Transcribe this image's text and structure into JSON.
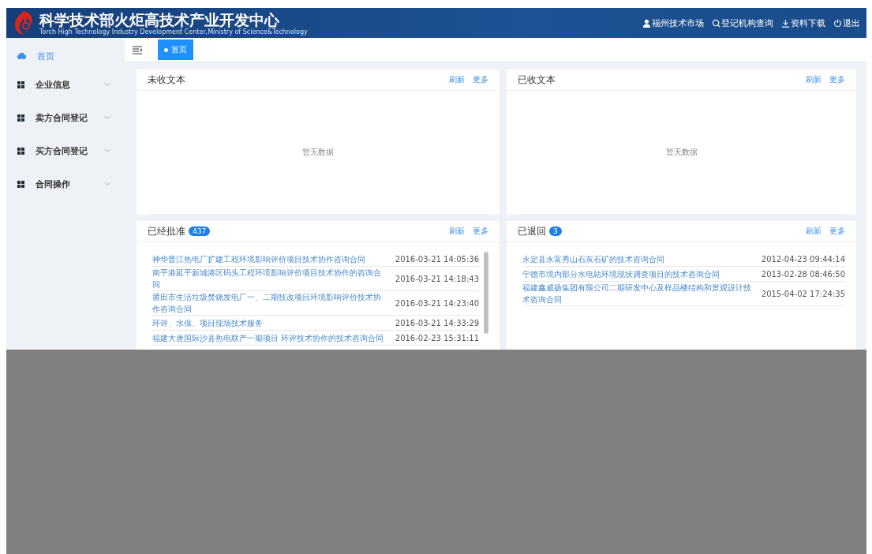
{
  "header": {
    "title": "科学技术部火炬高技术产业开发中心",
    "subtitle": "Torch High Technology Industry Development Center,Ministry of Science&Technology",
    "links": [
      {
        "kind": "user",
        "label": "福州技术市场"
      },
      {
        "kind": "search",
        "label": "登记机构查询"
      },
      {
        "kind": "download",
        "label": "资料下载"
      },
      {
        "kind": "power",
        "label": "退出"
      }
    ]
  },
  "sidebar": {
    "items": [
      {
        "kind": "home",
        "label": "首页",
        "selected": true
      },
      {
        "kind": "group",
        "label": "企业信息",
        "selected": false,
        "expanded": false
      },
      {
        "kind": "group",
        "label": "卖方合同登记",
        "selected": false,
        "expanded": false
      },
      {
        "kind": "group",
        "label": "买方合同登记",
        "selected": false,
        "expanded": false
      },
      {
        "kind": "group",
        "label": "合同操作",
        "selected": false,
        "expanded": false
      }
    ]
  },
  "tabs": [
    {
      "label": "首页",
      "selected": true
    }
  ],
  "panels": [
    {
      "title": "未收文本",
      "actions": [
        "刷新",
        "更多"
      ],
      "empty_text": "暂无数据"
    },
    {
      "title": "已收文本",
      "actions": [
        "刷新",
        "更多"
      ],
      "empty_text": "暂无数据"
    },
    {
      "title": "已经批准",
      "badge": "437",
      "actions": [
        "刷新",
        "更多"
      ],
      "scrollable": true,
      "rows": [
        {
          "title": "神华晋江热电厂扩建工程环境影响评价项目技术协作咨询合同",
          "date": "2016-03-21 14:05:36"
        },
        {
          "title": "南平港延平新城港区码头工程环境影响评价项目技术协作的咨询合同",
          "date": "2016-03-21 14:18:43"
        },
        {
          "title": "莆田市生活垃圾焚烧发电厂一、二期技改项目环境影响评价技术协作咨询合同",
          "date": "2016-03-21 14:23:40"
        },
        {
          "title": "环评、水保、项目现场技术服务",
          "date": "2016-03-21 14:33:29"
        },
        {
          "title": "福建大唐国际沙县热电联产一期项目 环评技术协作的技术咨询合同",
          "date": "2016-02-23 15:31:11"
        }
      ]
    },
    {
      "title": "已退回",
      "badge": "3",
      "actions": [
        "刷新",
        "更多"
      ],
      "rows": [
        {
          "title": "永定县永富秀山石灰石矿的技术咨询合同",
          "date": "2012-04-23 09:44:14"
        },
        {
          "title": "宁德市境内部分水电站环境现状调查项目的技术咨询合同",
          "date": "2013-02-28 08:46:50"
        },
        {
          "title": "福建鑫威扬集团有限公司二期研发中心及样品楼结构和景观设计技术咨询合同",
          "date": "2015-04-02 17:24:35"
        }
      ]
    }
  ]
}
